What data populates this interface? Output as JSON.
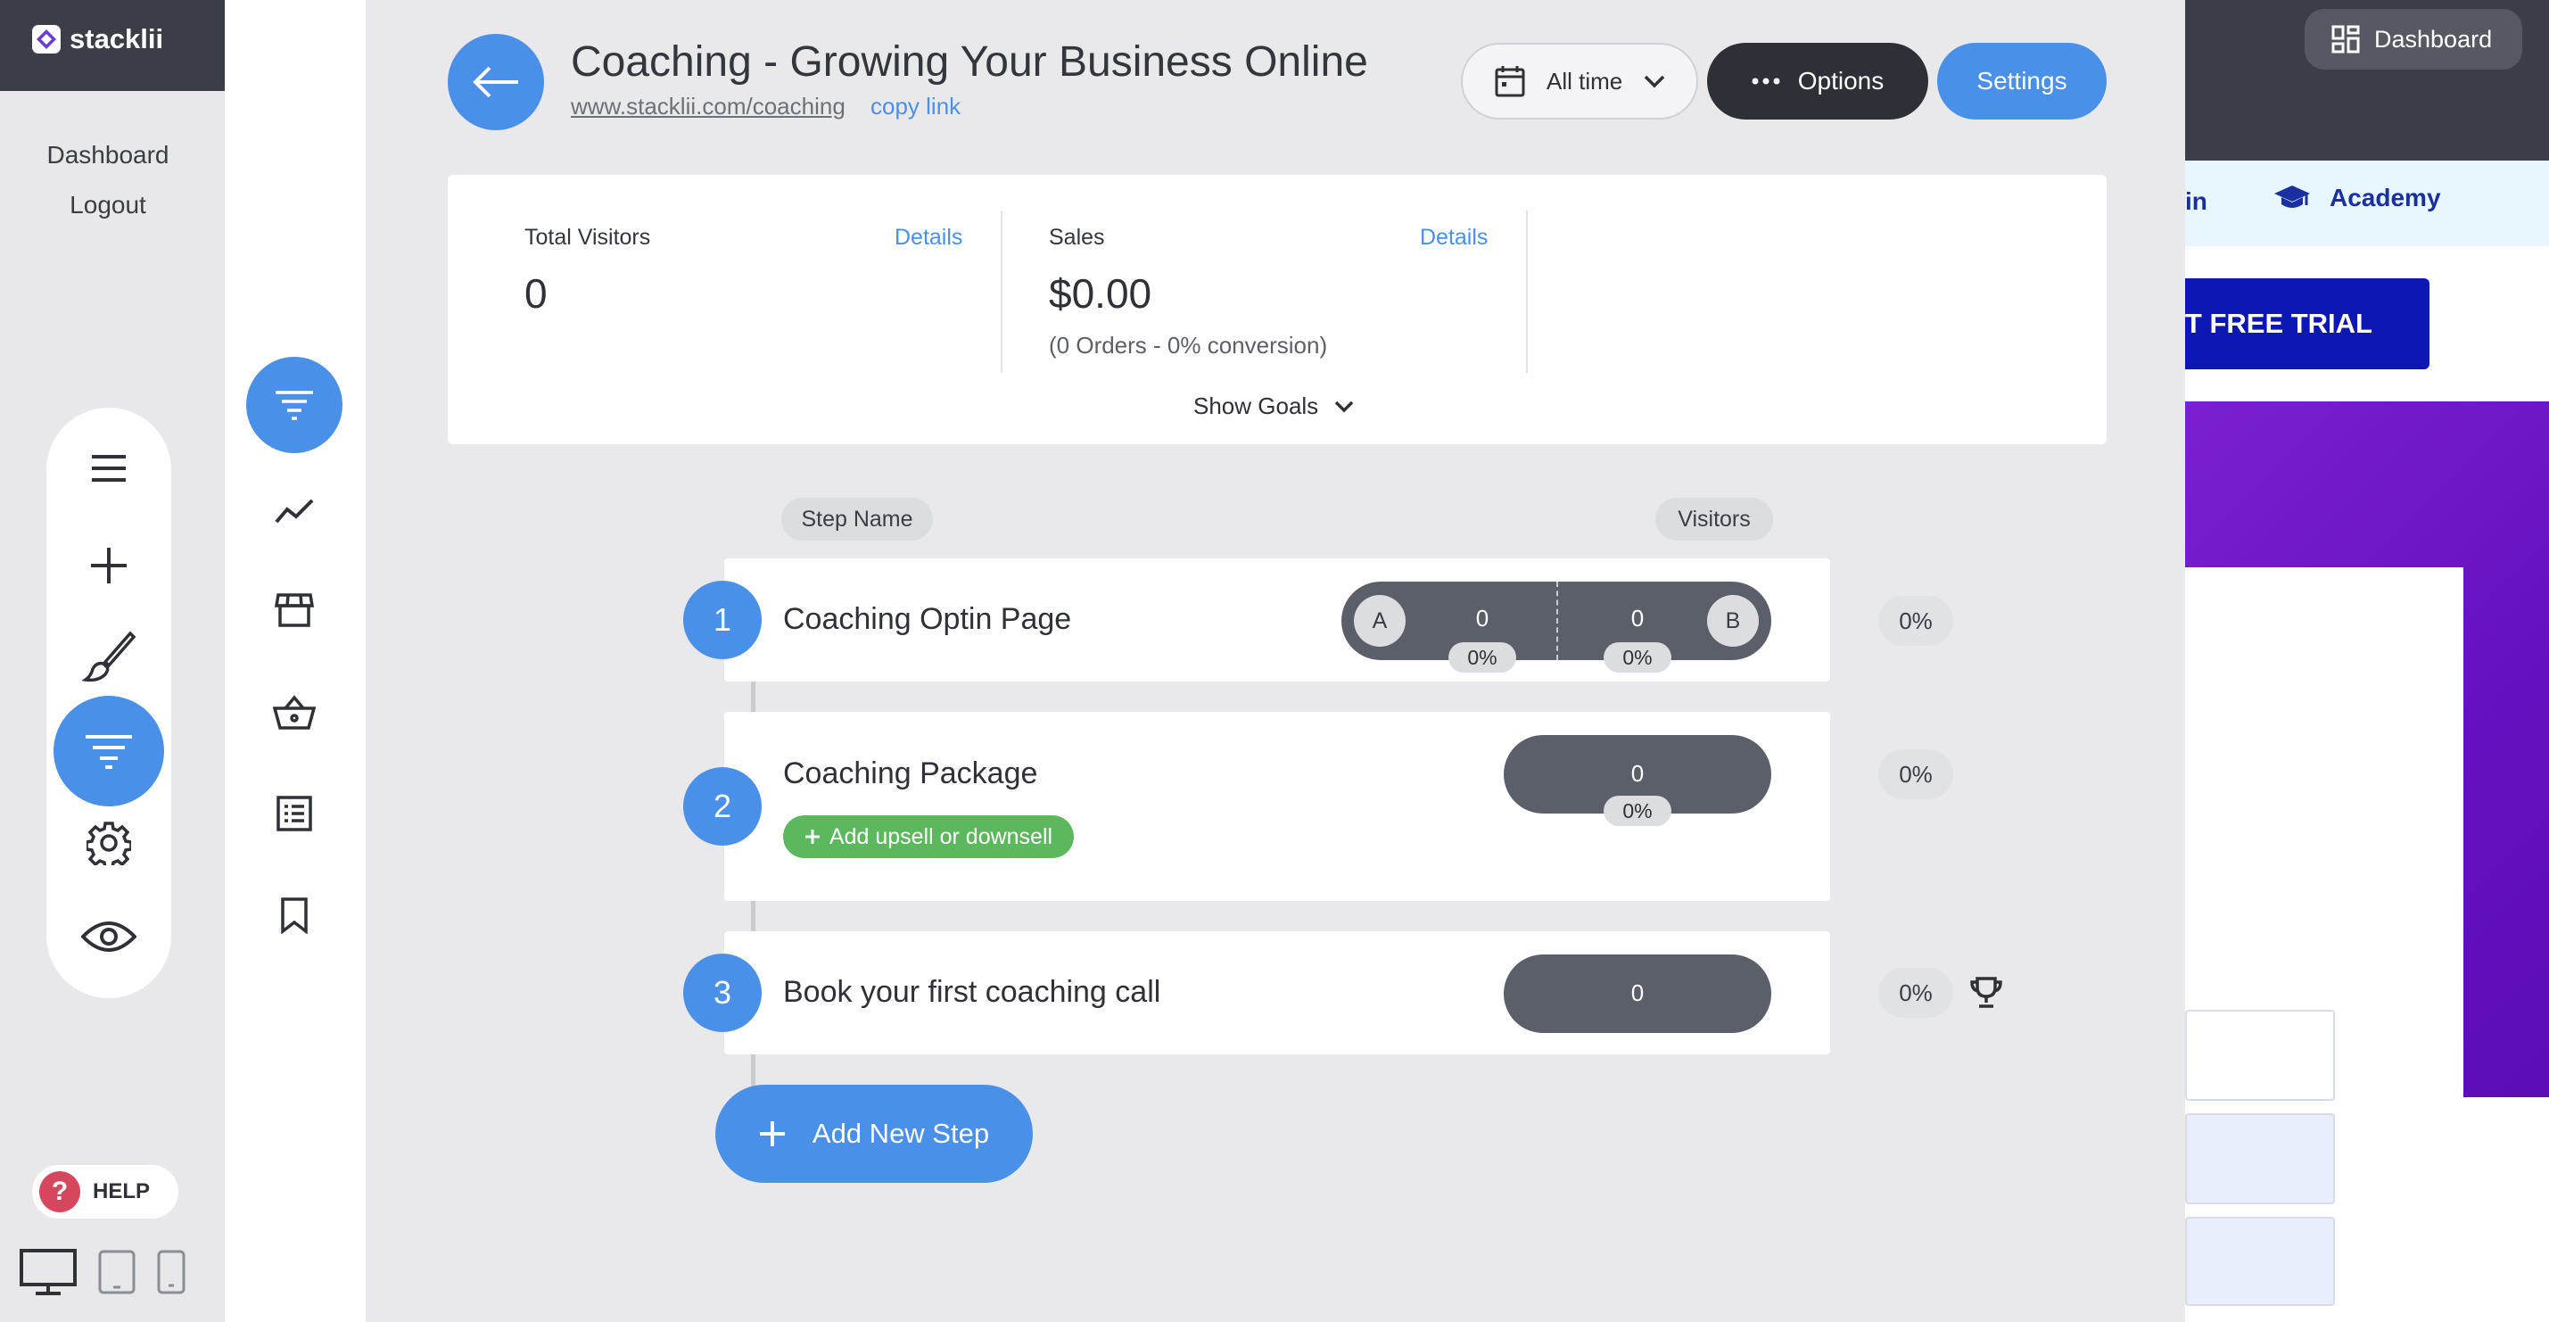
{
  "app": {
    "logo_text": "stacklii"
  },
  "left_sidebar": {
    "links": [
      "Dashboard",
      "Logout"
    ],
    "help_label": "HELP",
    "help_glyph": "?"
  },
  "right_preview": {
    "dashboard_label": "Dashboard",
    "nav_login_partial": "in",
    "nav_academy": "Academy",
    "trial_partial": "ART FREE TRIAL"
  },
  "header": {
    "title": "Coaching - Growing Your Business Online",
    "url": "www.stacklii.com/coaching",
    "copy_link": "copy link",
    "date_range": "All time",
    "options_label": "Options",
    "settings_label": "Settings"
  },
  "stats": {
    "visitors_label": "Total Visitors",
    "visitors_details": "Details",
    "visitors_value": "0",
    "sales_label": "Sales",
    "sales_details": "Details",
    "sales_value": "$0.00",
    "sales_sub": "(0 Orders - 0% conversion)",
    "show_goals": "Show Goals"
  },
  "columns": {
    "step_name": "Step Name",
    "visitors": "Visitors"
  },
  "steps": [
    {
      "number": "1",
      "name": "Coaching Optin Page",
      "variant_a": "A",
      "variant_b": "B",
      "a_visitors": "0",
      "a_pct": "0%",
      "b_visitors": "0",
      "b_pct": "0%",
      "conversion": "0%"
    },
    {
      "number": "2",
      "name": "Coaching Package",
      "visitors": "0",
      "pct": "0%",
      "conversion": "0%",
      "upsell_label": "Add upsell or downsell"
    },
    {
      "number": "3",
      "name": "Book your first coaching call",
      "visitors": "0",
      "conversion": "0%"
    }
  ],
  "add_step_label": "Add New Step",
  "colors": {
    "primary": "#4a90e8",
    "dark": "#2d3036",
    "pill": "#5b5f6a",
    "green": "#5cb85c",
    "help_red": "#d6475d"
  },
  "icons": [
    "menu-icon",
    "plus-icon",
    "brush-icon",
    "funnel-icon",
    "gear-icon",
    "eye-icon",
    "analytics-icon",
    "store-icon",
    "basket-icon",
    "list-icon",
    "bookmark-icon",
    "arrow-left-icon",
    "calendar-icon",
    "chevron-down-icon",
    "dots-icon",
    "trophy-icon",
    "desktop-icon",
    "tablet-icon",
    "mobile-icon",
    "dashboard-grid-icon",
    "graduation-cap-icon"
  ]
}
